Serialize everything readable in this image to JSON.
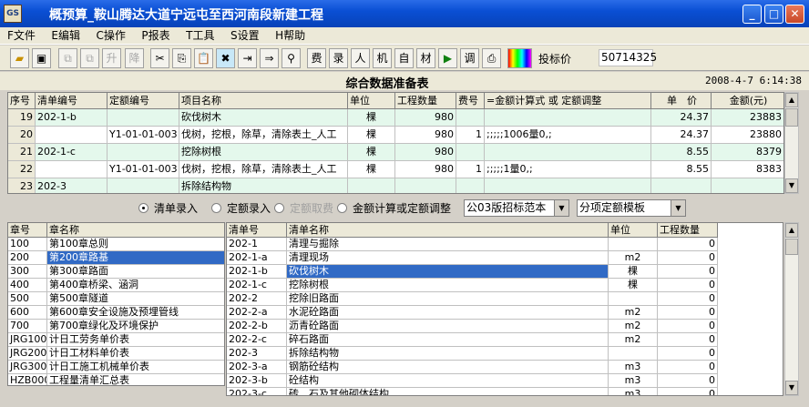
{
  "window": {
    "title": "概预算_鞍山腾达大道宁远屯至西河南段新建工程"
  },
  "menu": [
    "F文件",
    "E编辑",
    "C操作",
    "P报表",
    "T工具",
    "S设置",
    "H帮助"
  ],
  "toolbar": {
    "icons": [
      "open-icon",
      "save-icon",
      "copy-disabled-icon",
      "paste-disabled-icon",
      "up-label",
      "down-label",
      "cut-icon",
      "copy-icon",
      "paste-icon",
      "delete-icon",
      "insert-row-icon",
      "append-row-icon",
      "find-icon"
    ],
    "text_buttons": [
      "升",
      "降",
      "费",
      "录",
      "人",
      "机",
      "自",
      "材",
      "调"
    ],
    "price_label": "投标价",
    "price_value": "50714325"
  },
  "report": {
    "title": "综合数据准备表",
    "datetime": "2008-4-7 6:14:38"
  },
  "main_table": {
    "headers": [
      "序号",
      "清单编号",
      "定额编号",
      "项目名称",
      "单位",
      "工程数量",
      "费号",
      "=金额计算式 或 定额调整",
      "单　价",
      "金额(元)"
    ],
    "rows": [
      {
        "no": "19",
        "bill": "202-1-b",
        "quota": "",
        "name": "砍伐树木",
        "unit": "棵",
        "qty": "980",
        "fee": "",
        "calc": "",
        "price": "24.37",
        "amount": "23883",
        "green": true
      },
      {
        "no": "20",
        "bill": "",
        "quota": "Y1-01-01-003",
        "name": "伐树，挖根，除草，清除表土_人工",
        "unit": "棵",
        "qty": "980",
        "fee": "1",
        "calc": ";;;;;1006量0,;",
        "price": "24.37",
        "amount": "23880",
        "green": false
      },
      {
        "no": "21",
        "bill": "202-1-c",
        "quota": "",
        "name": "挖除树根",
        "unit": "棵",
        "qty": "980",
        "fee": "",
        "calc": "",
        "price": "8.55",
        "amount": "8379",
        "green": true
      },
      {
        "no": "22",
        "bill": "",
        "quota": "Y1-01-01-003",
        "name": "伐树，挖根，除草，清除表土_人工",
        "unit": "棵",
        "qty": "980",
        "fee": "1",
        "calc": ";;;;;1量0,;",
        "price": "8.55",
        "amount": "8383",
        "green": false
      },
      {
        "no": "23",
        "bill": "202-3",
        "quota": "",
        "name": "拆除结构物",
        "unit": "",
        "qty": "",
        "fee": "",
        "calc": "",
        "price": "",
        "amount": "",
        "green": true
      }
    ]
  },
  "options": {
    "radios": [
      {
        "label": "清单录入",
        "checked": true,
        "disabled": false
      },
      {
        "label": "定额录入",
        "checked": false,
        "disabled": false
      },
      {
        "label": "定额取费",
        "checked": false,
        "disabled": true
      },
      {
        "label": "金额计算或定额调整",
        "checked": false,
        "disabled": false
      }
    ],
    "template_select": "公03版招标范本",
    "quota_template_select": "分项定额模板"
  },
  "chapter_table": {
    "headers": [
      "章号",
      "章名称"
    ],
    "rows": [
      {
        "code": "100",
        "name": "第100章总则"
      },
      {
        "code": "200",
        "name": "第200章路基",
        "selected": true
      },
      {
        "code": "300",
        "name": "第300章路面"
      },
      {
        "code": "400",
        "name": "第400章桥梁、涵洞"
      },
      {
        "code": "500",
        "name": "第500章隧道"
      },
      {
        "code": "600",
        "name": "第600章安全设施及预埋管线"
      },
      {
        "code": "700",
        "name": "第700章绿化及环境保护"
      },
      {
        "code": "JRG100",
        "name": "计日工劳务单价表"
      },
      {
        "code": "JRG200",
        "name": "计日工材料单价表"
      },
      {
        "code": "JRG300",
        "name": "计日工施工机械单价表"
      },
      {
        "code": "HZB000",
        "name": "工程量清单汇总表"
      }
    ]
  },
  "bill_table": {
    "headers": [
      "清单号",
      "清单名称",
      "单位",
      "工程数量"
    ],
    "rows": [
      {
        "code": "202-1",
        "name": "清理与掘除",
        "unit": "",
        "qty": "0"
      },
      {
        "code": "202-1-a",
        "name": "清理现场",
        "unit": "m2",
        "qty": "0"
      },
      {
        "code": "202-1-b",
        "name": "砍伐树木",
        "unit": "棵",
        "qty": "0",
        "selected": true
      },
      {
        "code": "202-1-c",
        "name": "挖除树根",
        "unit": "棵",
        "qty": "0"
      },
      {
        "code": "202-2",
        "name": "挖除旧路面",
        "unit": "",
        "qty": "0"
      },
      {
        "code": "202-2-a",
        "name": "水泥砼路面",
        "unit": "m2",
        "qty": "0"
      },
      {
        "code": "202-2-b",
        "name": "沥青砼路面",
        "unit": "m2",
        "qty": "0"
      },
      {
        "code": "202-2-c",
        "name": "碎石路面",
        "unit": "m2",
        "qty": "0"
      },
      {
        "code": "202-3",
        "name": "拆除结构物",
        "unit": "",
        "qty": "0"
      },
      {
        "code": "202-3-a",
        "name": "钢筋砼结构",
        "unit": "m3",
        "qty": "0"
      },
      {
        "code": "202-3-b",
        "name": "砼结构",
        "unit": "m3",
        "qty": "0"
      },
      {
        "code": "202-3-c",
        "name": "砖、石及其他砌体结构",
        "unit": "m3",
        "qty": "0"
      }
    ]
  }
}
